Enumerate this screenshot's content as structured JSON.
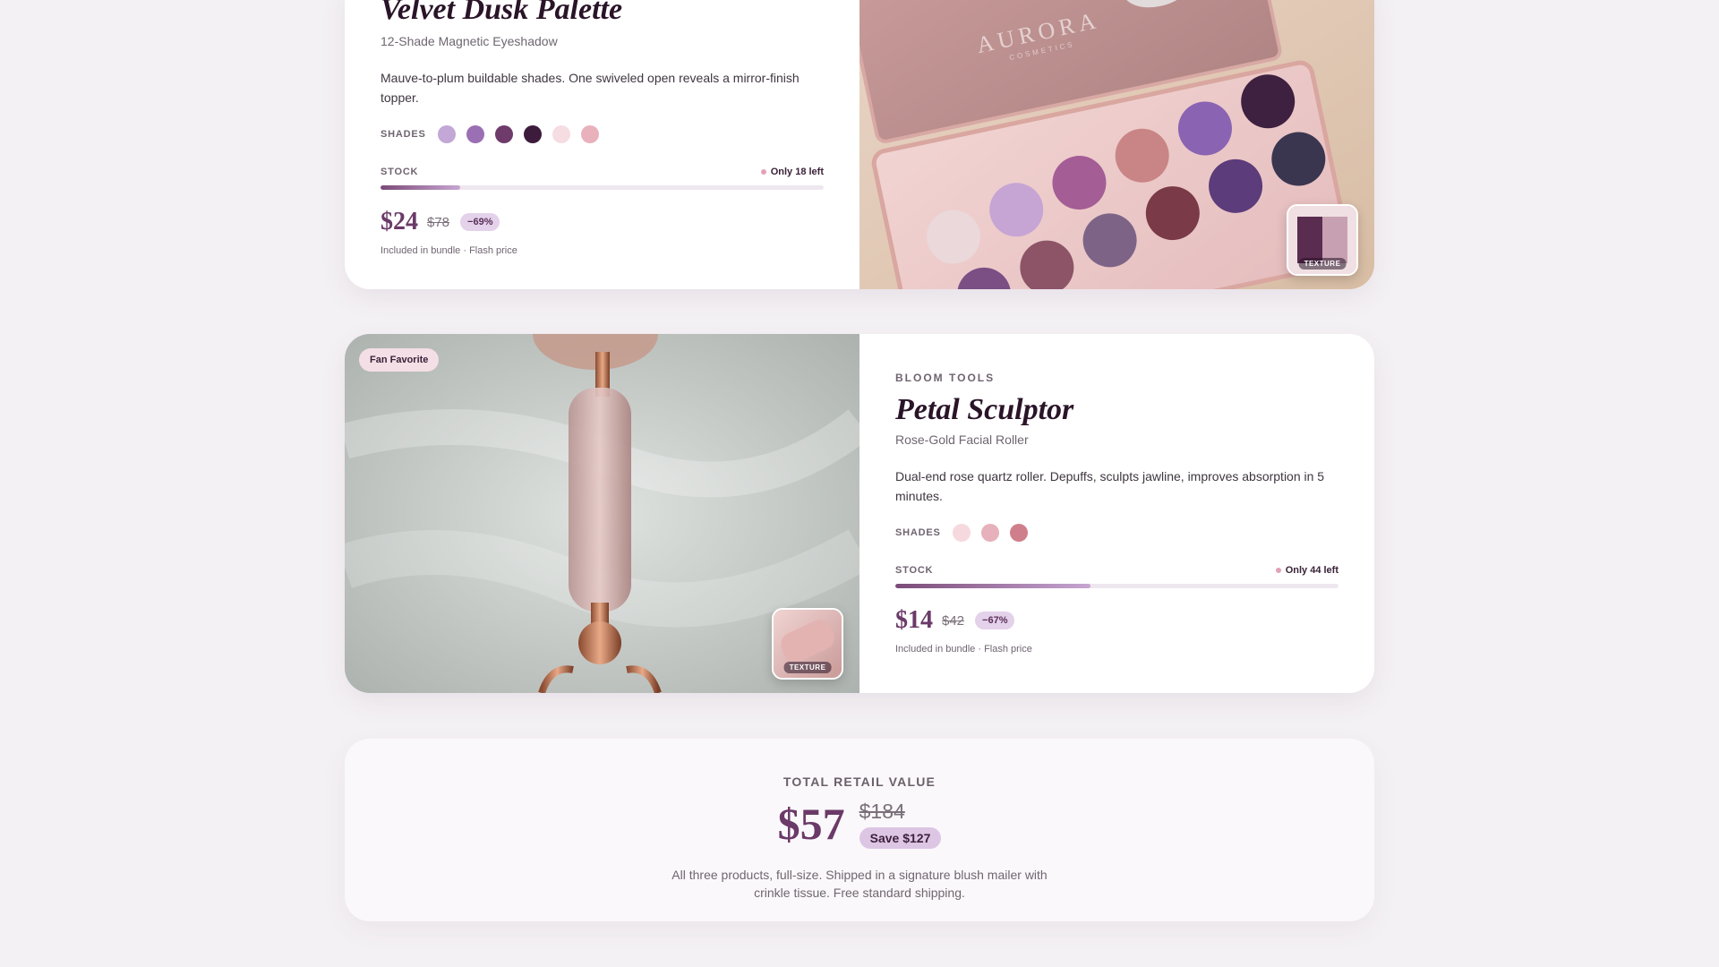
{
  "products": [
    {
      "title": "Velvet Dusk Palette",
      "subtitle": "12-Shade Magnetic Eyeshadow",
      "description": "Mauve-to-plum buildable shades. One swiveled open reveals a mirror-finish topper.",
      "shades_label": "SHADES",
      "shades": [
        "#c3a7d6",
        "#9b6fb3",
        "#6e3b6b",
        "#3d1b3d",
        "#f6dde2",
        "#e8b1bb"
      ],
      "stock_label": "STOCK",
      "stock_note": "Only 18 left",
      "stock_level_pct": 18,
      "price": "$24",
      "was": "$78",
      "discount": "−69%",
      "price_note": "Included in bundle · Flash price",
      "texture_label": "TEXTURE",
      "palette_brand": "AURORA",
      "palette_brand_sub": "COSMETICS"
    },
    {
      "badge": "Fan Favorite",
      "brand": "BLOOM TOOLS",
      "title": "Petal Sculptor",
      "subtitle": "Rose-Gold Facial Roller",
      "description": "Dual-end rose quartz roller. Depuffs, sculpts jawline, improves absorption in 5 minutes.",
      "shades_label": "SHADES",
      "shades": [
        "#f6d9de",
        "#e6b1ba",
        "#cf7f8b"
      ],
      "stock_label": "STOCK",
      "stock_note": "Only 44 left",
      "stock_level_pct": 44,
      "price": "$14",
      "was": "$42",
      "discount": "−67%",
      "price_note": "Included in bundle · Flash price",
      "texture_label": "TEXTURE"
    }
  ],
  "summary": {
    "label": "TOTAL RETAIL VALUE",
    "price": "$57",
    "was": "$184",
    "save": "Save $127",
    "text": "All three products, full-size. Shipped in a signature blush mailer with crinkle tissue. Free standard shipping."
  }
}
